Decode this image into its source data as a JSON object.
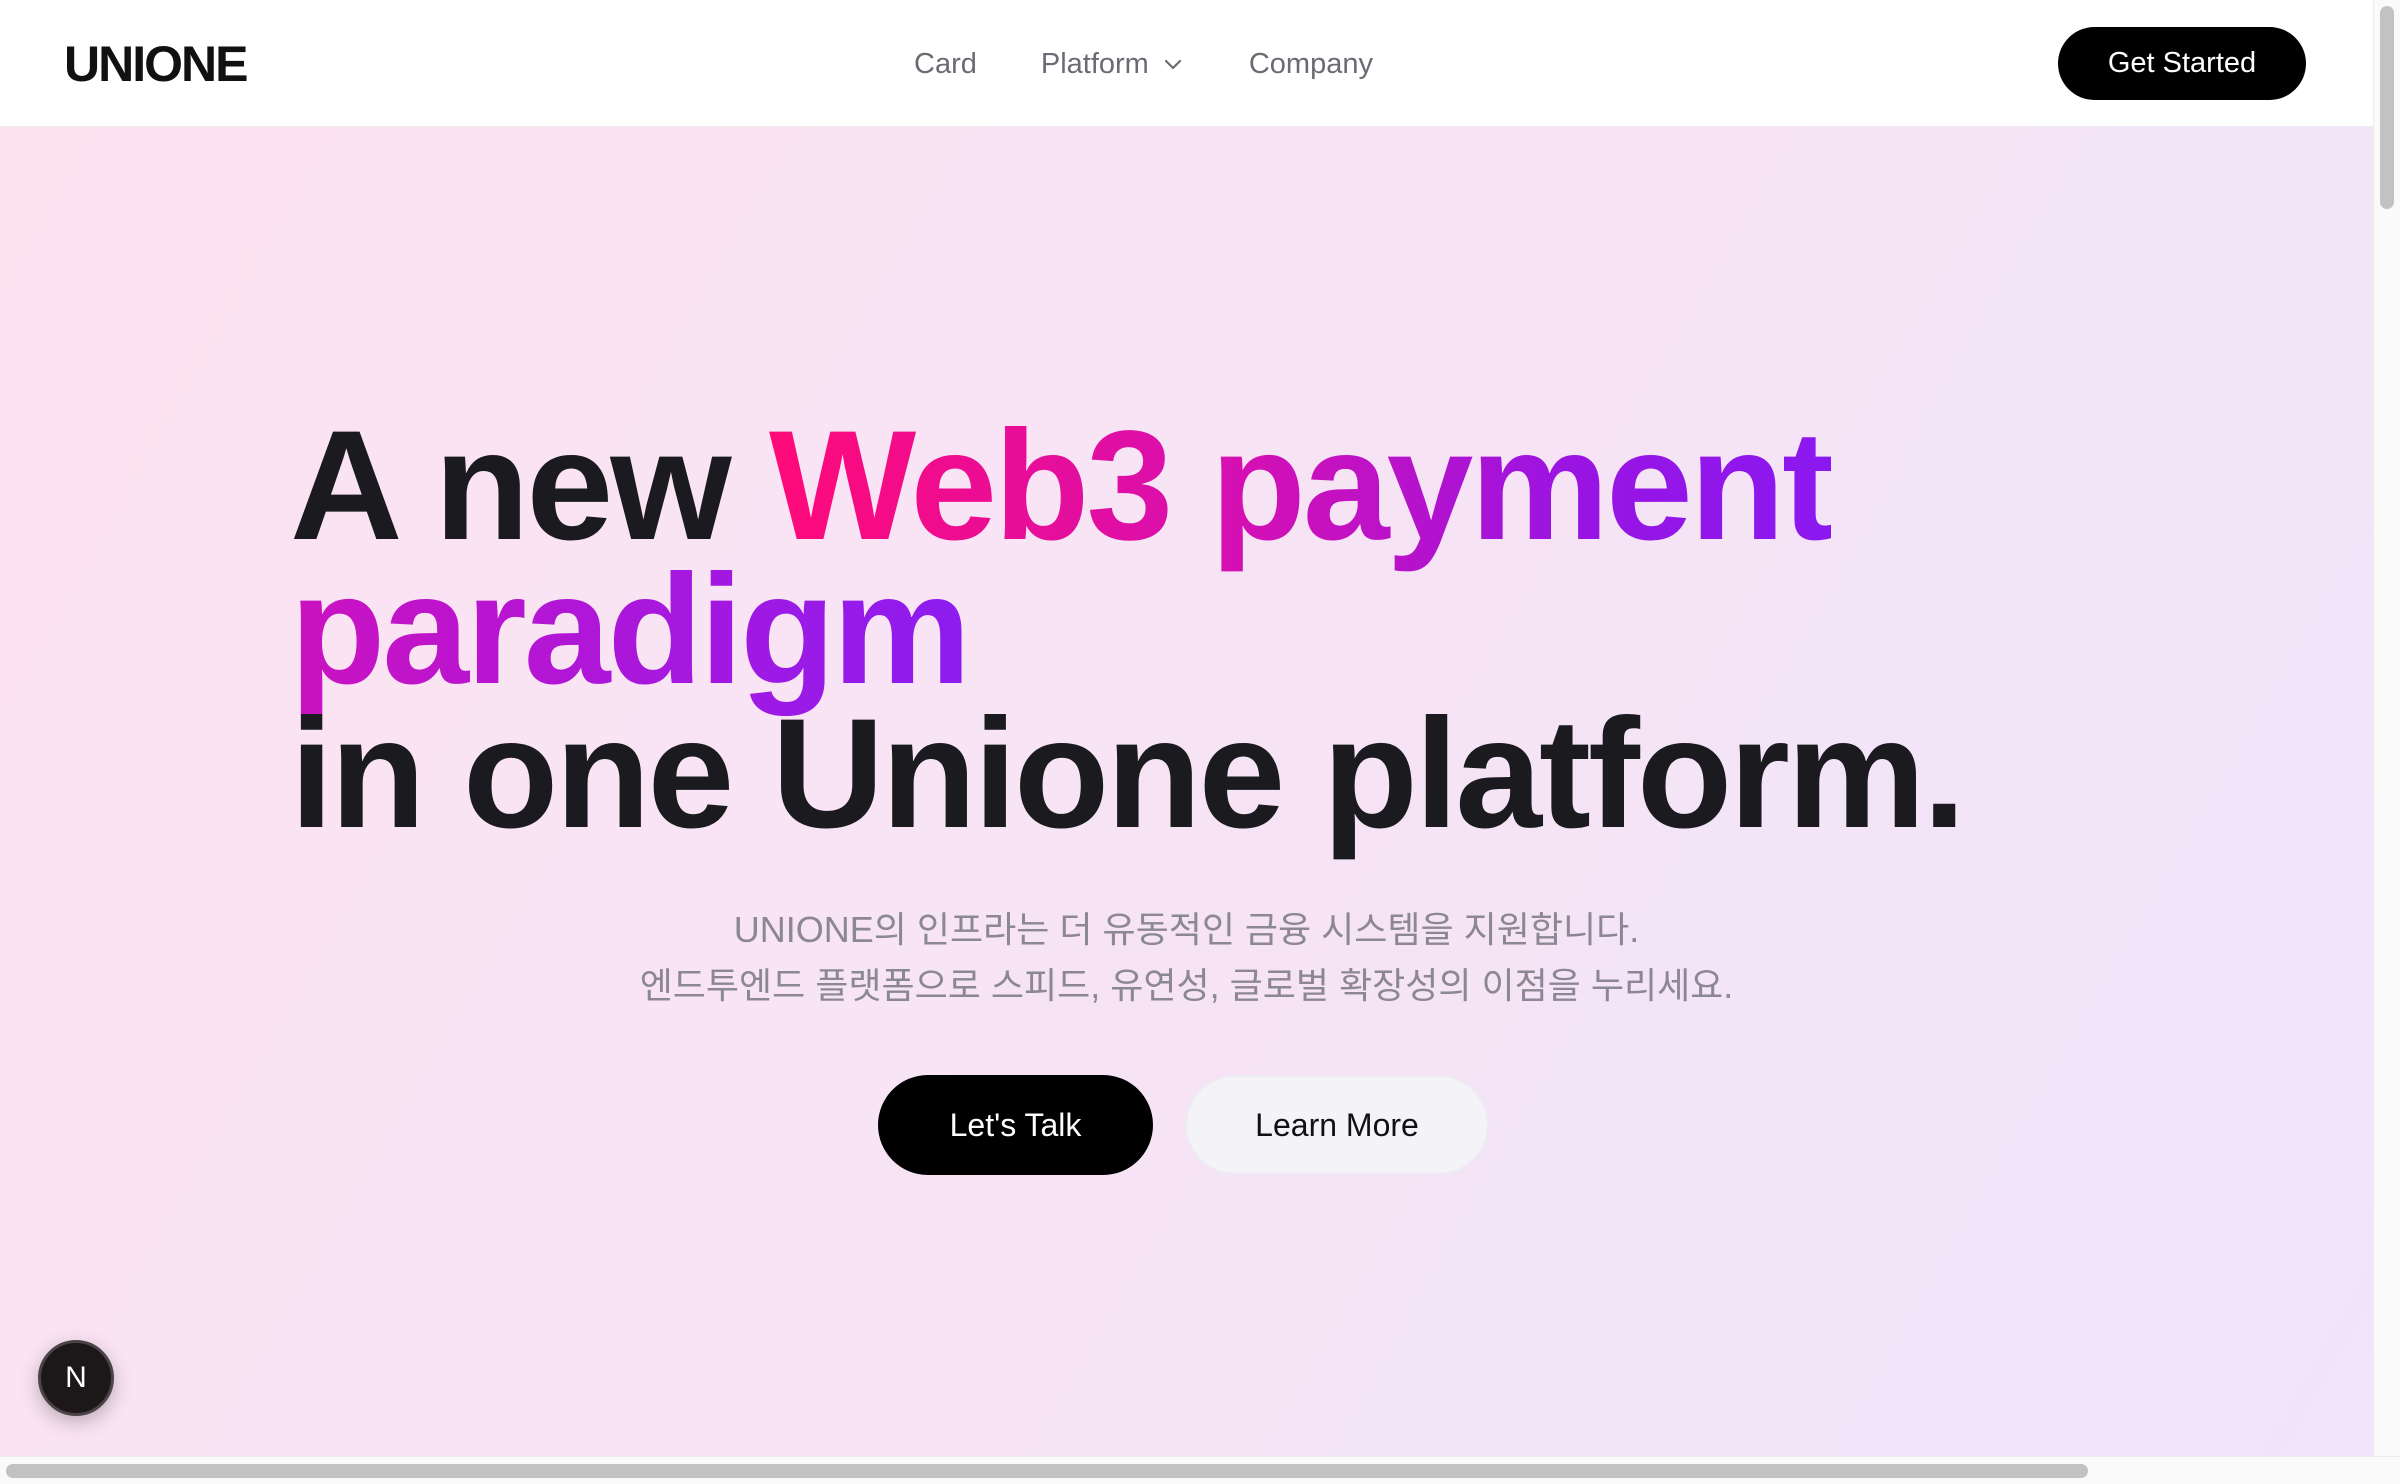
{
  "navbar": {
    "logo": "UNIONE",
    "links": [
      {
        "label": "Card"
      },
      {
        "label": "Platform"
      },
      {
        "label": "Company"
      }
    ],
    "cta_label": "Get Started"
  },
  "hero": {
    "headline": {
      "part1": "A new ",
      "highlight1": "Web3 payment",
      "highlight2": "paradigm",
      "line3": "in one Unione platform."
    },
    "subtitle": [
      "UNIONE의 인프라는 더 유동적인 금융 시스템을 지원합니다.",
      "엔드투엔드 플랫폼으로 스피드, 유연성, 글로벌 확장성의 이점을 누리세요."
    ],
    "primary_button": "Let's Talk",
    "secondary_button": "Learn More"
  },
  "dev_badge": {
    "label": "N"
  },
  "icons": {
    "platform_dropdown": "chevron-down-icon"
  },
  "colors": {
    "accent_pink": "#ff0a78",
    "accent_purple": "#8a18f0",
    "primary_button": "#000000",
    "hero_background": "#f8e4f4"
  }
}
